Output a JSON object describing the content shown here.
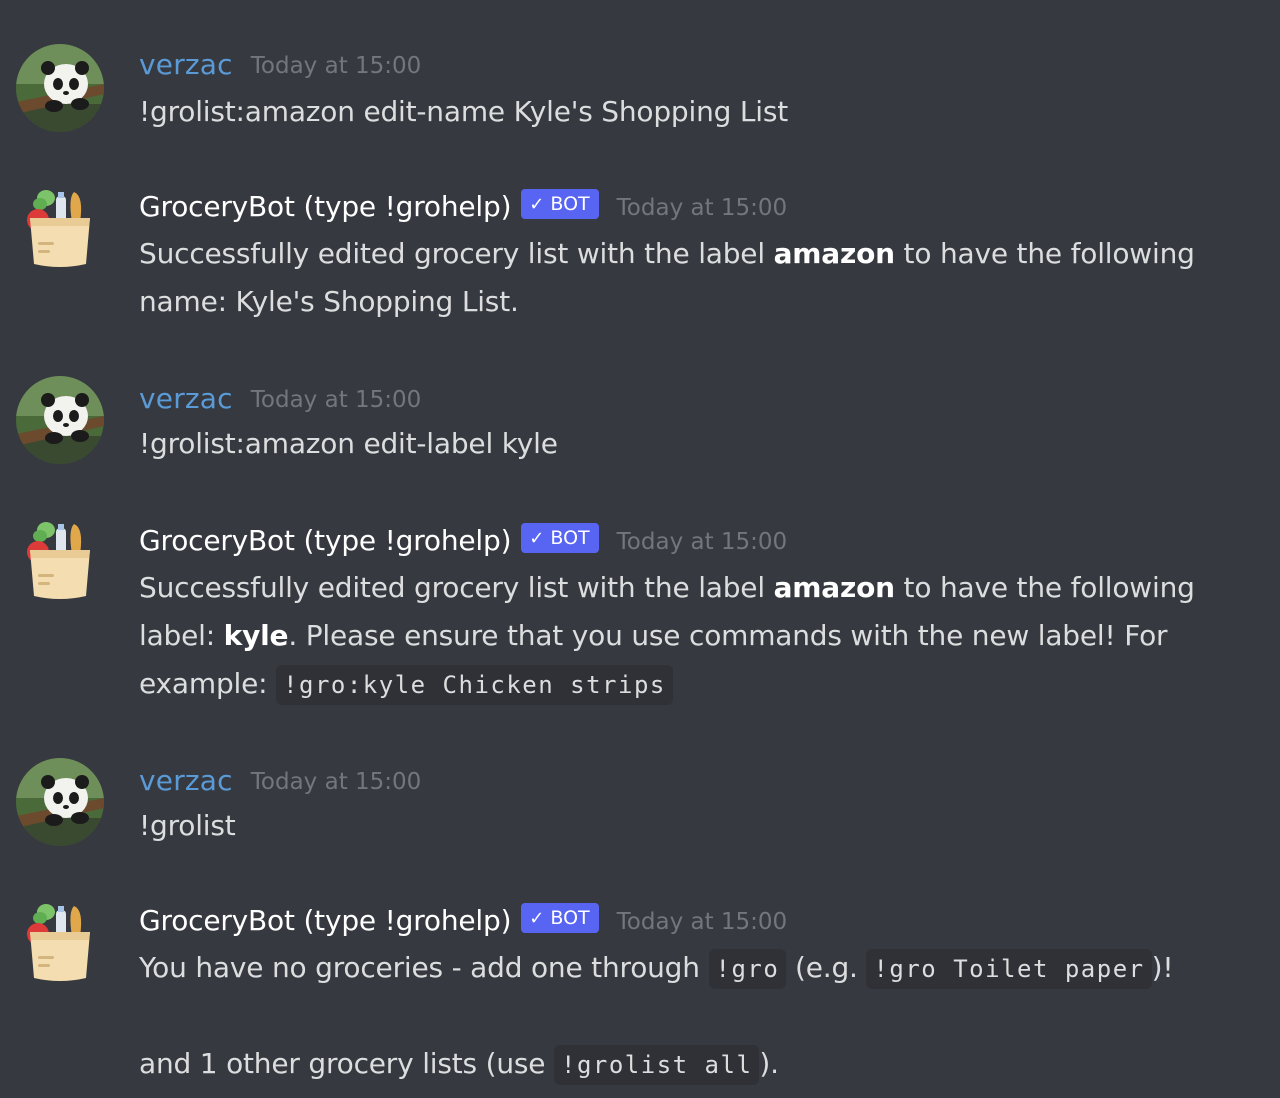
{
  "users": {
    "human": {
      "name": "verzac",
      "avatar_icon": "panda-avatar-icon"
    },
    "bot": {
      "name": "GroceryBot (type !grohelp)",
      "tag": "BOT",
      "tag_check": "✓",
      "avatar_icon": "grocery-bag-icon"
    }
  },
  "colors": {
    "background": "#36393f",
    "human_name": "#5a9ad6",
    "bot_tag": "#5865f2",
    "code_bg": "#2f3136",
    "timestamp": "#72767d"
  },
  "messages": [
    {
      "author": "verzac",
      "timestamp": "Today at 15:00",
      "text": "!grolist:amazon edit-name Kyle's Shopping List"
    },
    {
      "author": "GroceryBot (type !grohelp)",
      "timestamp": "Today at 15:00",
      "text_a": "Successfully edited grocery list with the label ",
      "bold_a": "amazon",
      "text_b": " to have the following name: Kyle's Shopping List."
    },
    {
      "author": "verzac",
      "timestamp": "Today at 15:00",
      "text": "!grolist:amazon edit-label kyle"
    },
    {
      "author": "GroceryBot (type !grohelp)",
      "timestamp": "Today at 15:00",
      "text_a": "Successfully edited grocery list with the label ",
      "bold_a": "amazon",
      "text_b": " to have the following label: ",
      "bold_b": "kyle",
      "text_c": ". Please ensure that you use commands with the new label! For example: ",
      "code_a": "!gro:kyle Chicken strips"
    },
    {
      "author": "verzac",
      "timestamp": "Today at 15:00",
      "text": "!grolist"
    },
    {
      "author": "GroceryBot (type !grohelp)",
      "timestamp": "Today at 15:00",
      "text_a": "You have no groceries - add one through ",
      "code_a": "!gro",
      "text_b": " (e.g. ",
      "code_b": "!gro Toilet paper",
      "text_c": ")!",
      "text_d": "and 1 other grocery lists (use ",
      "code_c": "!grolist all",
      "text_e": ")."
    }
  ]
}
